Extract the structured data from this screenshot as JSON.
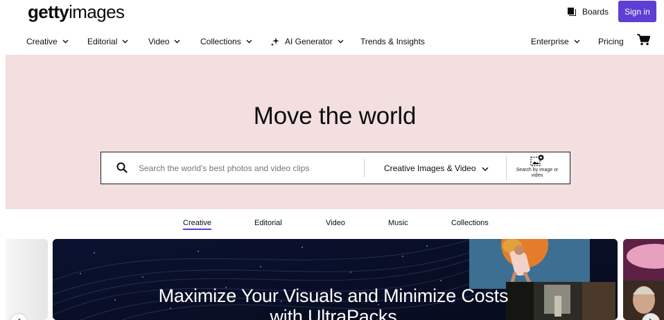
{
  "header": {
    "logo_bold": "getty",
    "logo_light": "images",
    "boards_label": "Boards",
    "signin_label": "Sign in"
  },
  "nav": {
    "items": [
      {
        "label": "Creative",
        "icon": "chevron-down-icon"
      },
      {
        "label": "Editorial",
        "icon": "chevron-down-icon"
      },
      {
        "label": "Video",
        "icon": "chevron-down-icon"
      },
      {
        "label": "Collections",
        "icon": "chevron-down-icon"
      },
      {
        "label": "AI Generator",
        "icon": "chevron-down-icon"
      },
      {
        "label": "Trends & Insights"
      }
    ],
    "right_items": [
      {
        "label": "Enterprise",
        "icon": "chevron-down-icon"
      },
      {
        "label": "Pricing"
      }
    ]
  },
  "hero": {
    "title": "Move the world",
    "search": {
      "placeholder": "Search the world's best photos and video clips",
      "value": "",
      "type_selected": "Creative Images & Video",
      "visual_search_label": "Search by image or video"
    }
  },
  "media_tabs": [
    {
      "label": "Creative",
      "active": true
    },
    {
      "label": "Editorial",
      "active": false
    },
    {
      "label": "Video",
      "active": false
    },
    {
      "label": "Music",
      "active": false
    },
    {
      "label": "Collections",
      "active": false
    }
  ],
  "carousel": {
    "banner_title": "Maximize Your Visuals and Minimize Costs with UltraPacks"
  },
  "colors": {
    "accent": "#5d3fd3",
    "hero_bg": "#f3dfdf",
    "text": "#0c0d0d",
    "banner_bg": "#0a0f26"
  }
}
